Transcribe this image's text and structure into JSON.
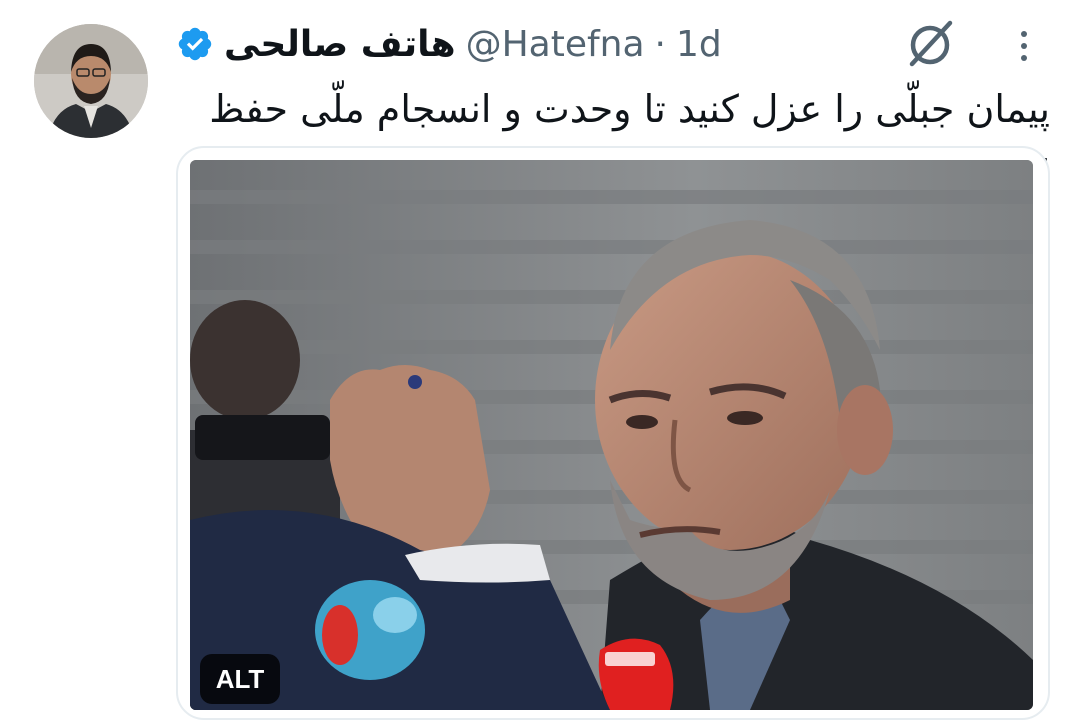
{
  "tweet": {
    "display_name": "هاتف صالحی",
    "handle": "@Hatefna",
    "separator": "·",
    "time": "1d",
    "text": "پیمان جبلّی را عزل کنید تا وحدت و انسجام ملّی حفظ شود."
  },
  "media": {
    "alt_label": "ALT"
  },
  "icons": {
    "verified": "verified-badge-icon",
    "grok": "grok-icon",
    "more": "more-options-icon"
  },
  "colors": {
    "verified": "#1d9bf0",
    "text": "#0f1419",
    "secondary": "#536471"
  }
}
